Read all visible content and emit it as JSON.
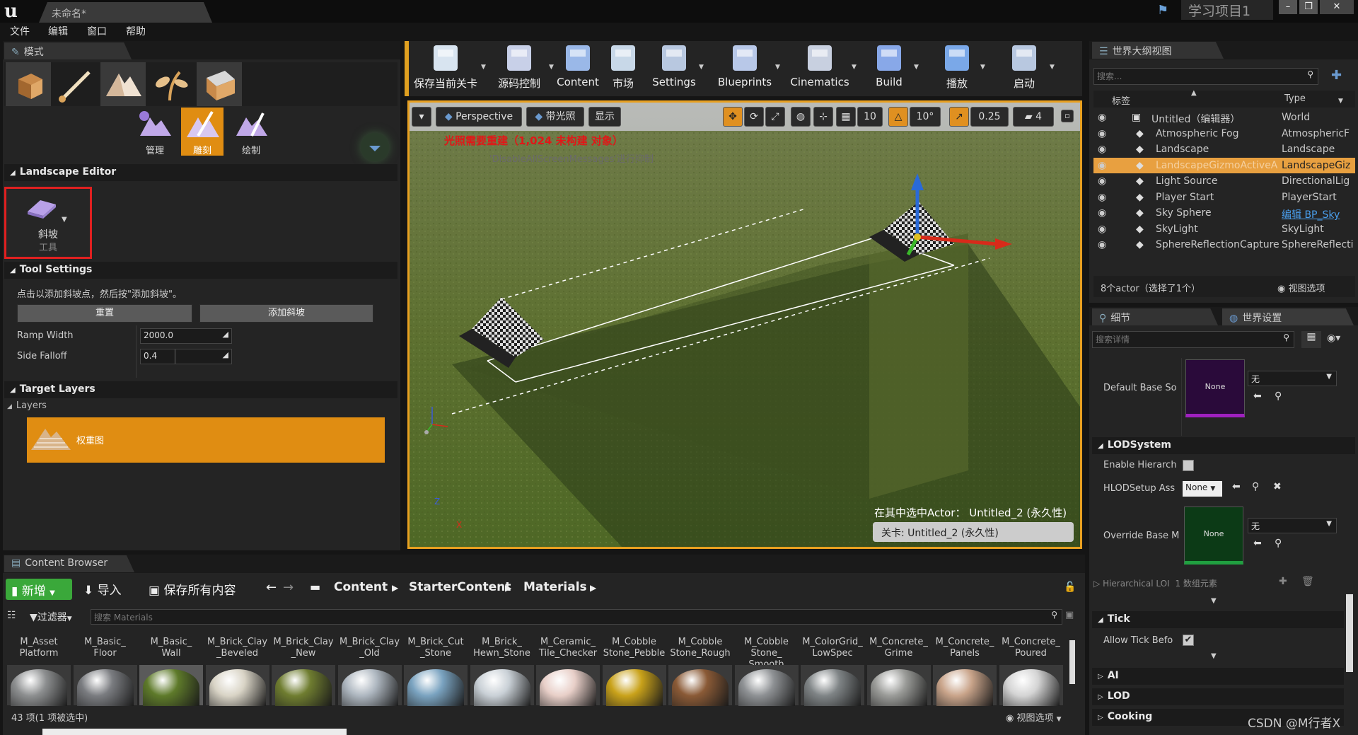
{
  "title_bar": {
    "logo": "u",
    "doc_tab": "未命名*",
    "project": "学习项目1",
    "window_buttons": [
      "–",
      "❐",
      "✕"
    ]
  },
  "menu": [
    "文件",
    "编辑",
    "窗口",
    "帮助"
  ],
  "modes_panel": {
    "tab": "模式",
    "mode_icons": [
      "place-mode-icon",
      "paint-mode-icon",
      "landscape-mode-icon",
      "foliage-mode-icon",
      "geometry-mode-icon"
    ],
    "sub_modes": [
      "管理",
      "雕刻",
      "绘制"
    ],
    "landscape_editor_header": "Landscape Editor",
    "tool": {
      "name": "斜坡",
      "sub": "工具"
    },
    "tool_settings_header": "Tool Settings",
    "hint": "点击以添加斜坡点，然后按\"添加斜坡\"。",
    "reset_btn": "重置",
    "add_ramp_btn": "添加斜坡",
    "ramp_width_label": "Ramp Width",
    "ramp_width_value": "2000.0",
    "side_falloff_label": "Side Falloff",
    "side_falloff_value": "0.4",
    "target_layers_header": "Target Layers",
    "layers_label": "Layers",
    "layer_item": "权重图"
  },
  "toolbar": [
    {
      "label": "保存当前关卡",
      "icon": "save-icon"
    },
    {
      "label": "源码控制",
      "icon": "source-control-icon"
    },
    {
      "label": "Content",
      "icon": "content-icon"
    },
    {
      "label": "市场",
      "icon": "marketplace-icon"
    },
    {
      "label": "Settings",
      "icon": "settings-icon"
    },
    {
      "label": "Blueprints",
      "icon": "blueprints-icon"
    },
    {
      "label": "Cinematics",
      "icon": "cinematics-icon"
    },
    {
      "label": "Build",
      "icon": "build-icon"
    },
    {
      "label": "播放",
      "icon": "play-icon"
    },
    {
      "label": "启动",
      "icon": "launch-icon"
    }
  ],
  "viewport": {
    "perspective": "Perspective",
    "lit": "带光照",
    "show": "显示",
    "grid_snap": "10",
    "rot_snap": "10°",
    "scale_snap": "0.25",
    "cam_speed": "4",
    "warning": "光照需要重建（1,024 未构建 对象）",
    "warning_sub": "'DisableAllScreenMessages'进行抑制",
    "selected_actor": "在其中选中Actor：  Untitled_2 (永久性)",
    "level": "关卡:  Untitled_2 (永久性)",
    "axis_z": "Z",
    "axis_x": "X"
  },
  "outliner": {
    "tab": "世界大纲视图",
    "search_placeholder": "搜索...",
    "col_label": "标签",
    "col_type": "Type",
    "rows": [
      {
        "label": "Untitled（编辑器）",
        "type": "World"
      },
      {
        "label": "Atmospheric Fog",
        "type": "AtmosphericF"
      },
      {
        "label": "Landscape",
        "type": "Landscape"
      },
      {
        "label": "LandscapeGizmoActiveA",
        "type": "LandscapeGiz"
      },
      {
        "label": "Light Source",
        "type": "DirectionalLig"
      },
      {
        "label": "Player Start",
        "type": "PlayerStart"
      },
      {
        "label": "Sky Sphere",
        "type": "编辑 BP_Sky"
      },
      {
        "label": "SkyLight",
        "type": "SkyLight"
      },
      {
        "label": "SphereReflectionCapture",
        "type": "SphereReflecti"
      }
    ],
    "footer_count": "8个actor（选择了1个）",
    "view_options": "视图选项"
  },
  "details": {
    "tab_details": "细节",
    "tab_world": "世界设置",
    "search_placeholder": "搜索详情",
    "default_base_label": "Default Base So",
    "none_thumb": "None",
    "none_dropdown": "无",
    "lod_system_header": "LODSystem",
    "enable_hier_label": "Enable Hierarch",
    "hlod_label": "HLODSetup Ass",
    "hlod_value": "None",
    "override_label": "Override Base M",
    "hierarchical_label": "Hierarchical LOI",
    "hierarchical_value": "1 数组元素",
    "tick_header": "Tick",
    "allow_tick_label": "Allow Tick Befo",
    "ai_header": "AI",
    "lod_header": "LOD",
    "cooking_header": "Cooking"
  },
  "content_browser": {
    "tab": "Content Browser",
    "new_btn": "新增",
    "import_btn": "导入",
    "save_all_btn": "保存所有内容",
    "path": [
      "Content",
      "StarterContent",
      "Materials"
    ],
    "filter_btn": "过滤器",
    "search_placeholder": "搜索 Materials",
    "assets": [
      {
        "name": "M_Asset\nPlatform",
        "color": "#8d8f90"
      },
      {
        "name": "M_Basic_\nFloor",
        "color": "#7a7c80"
      },
      {
        "name": "M_Basic_\nWall",
        "color": "#5e7a2a"
      },
      {
        "name": "M_Brick_Clay\n_Beveled",
        "color": "#d9d4c6"
      },
      {
        "name": "M_Brick_Clay\n_New",
        "color": "#6f7d30"
      },
      {
        "name": "M_Brick_Clay\n_Old",
        "color": "#aeb7c0"
      },
      {
        "name": "M_Brick_Cut\n_Stone",
        "color": "#7aa3c0"
      },
      {
        "name": "M_Brick_\nHewn_Stone",
        "color": "#c9d0d6"
      },
      {
        "name": "M_Ceramic_\nTile_Checker",
        "color": "#e8cfc8"
      },
      {
        "name": "M_Cobble\nStone_Pebble",
        "color": "#c9a21a"
      },
      {
        "name": "M_Cobble\nStone_Rough",
        "color": "#8a5a36"
      },
      {
        "name": "M_Cobble\nStone_\nSmooth",
        "color": "#8e9194"
      },
      {
        "name": "M_ColorGrid_\nLowSpec",
        "color": "#7f8486"
      },
      {
        "name": "M_Concrete_\nGrime",
        "color": "#9a9b98"
      },
      {
        "name": "M_Concrete_\nPanels",
        "color": "#c9a48a"
      },
      {
        "name": "M_Concrete_\nPoured",
        "color": "#d4d4d4"
      }
    ],
    "status": "43 项(1 项被选中)",
    "view_options": "视图选项"
  },
  "watermark": "CSDN @M行者X"
}
